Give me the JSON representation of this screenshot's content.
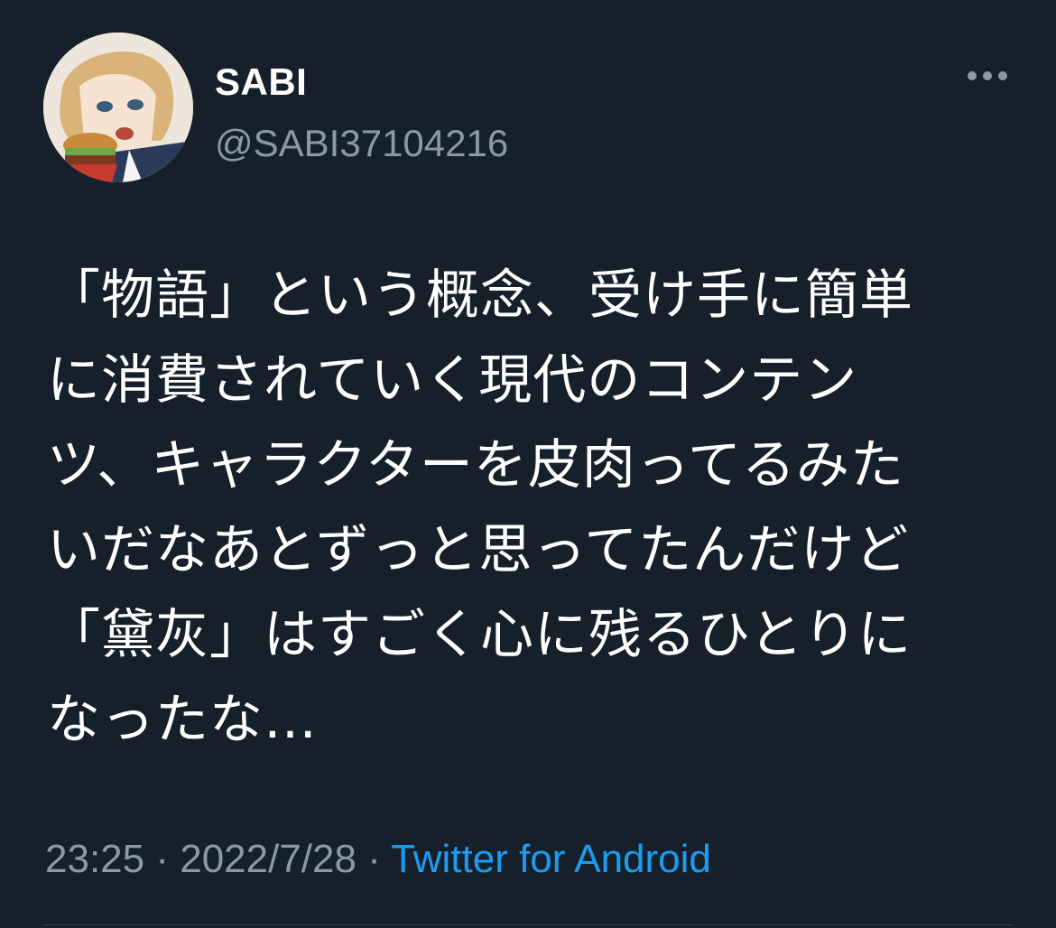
{
  "user": {
    "display_name": "SABI",
    "handle": "@SABI37104216",
    "avatar_icon": "avatar-illustration"
  },
  "tweet": {
    "text": "「物語」という概念、受け手に簡単\nに消費されていく現代のコンテン\nツ、キャラクターを皮肉ってるみた\nいだなあとずっと思ってたんだけど\n「黛灰」はすごく心に残るひとりに\nなったな…",
    "time": "23:25",
    "separator": " · ",
    "date": "2022/7/28",
    "source": "Twitter for Android"
  },
  "colors": {
    "background": "#15202b",
    "text": "#ffffff",
    "secondary": "#8b98a5",
    "link": "#1d9bf0"
  }
}
